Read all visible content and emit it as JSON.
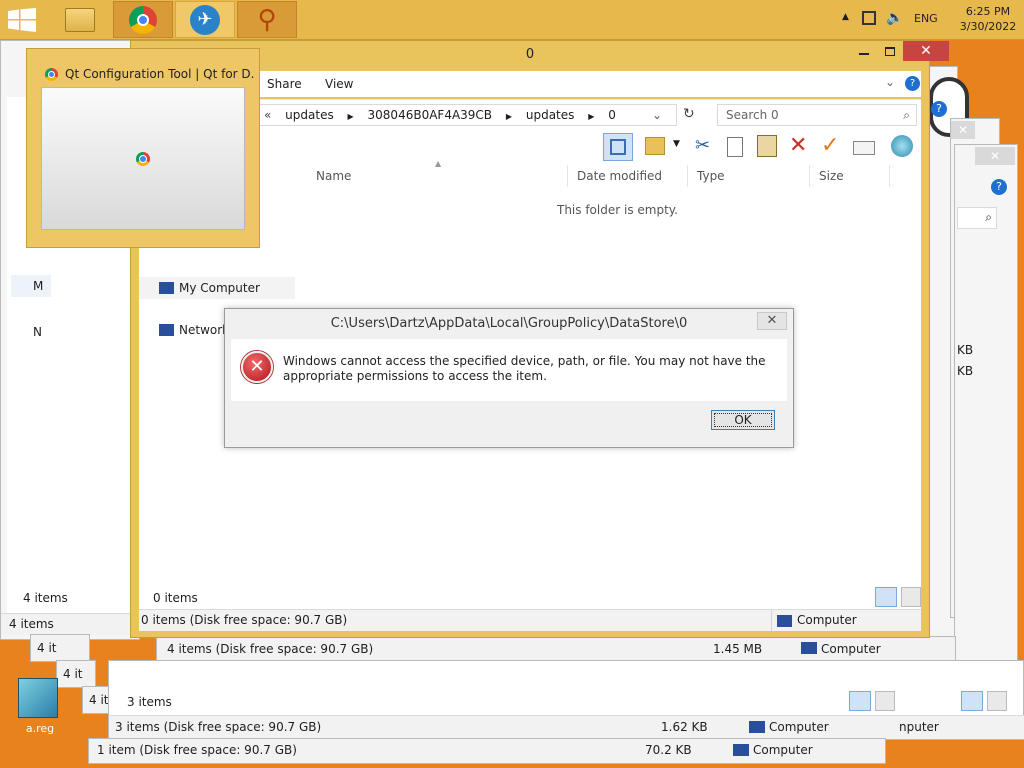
{
  "taskbar": {
    "language": "ENG",
    "time": "6:25 PM",
    "date": "3/30/2022"
  },
  "thumbnail": {
    "title": "Qt Configuration Tool | Qt for D..."
  },
  "front_window": {
    "title": "0",
    "tabs": [
      "Share",
      "View"
    ],
    "breadcrumb": [
      "updates",
      "308046B0AF4A39CB",
      "updates",
      "0"
    ],
    "search_placeholder": "Search 0",
    "columns": [
      "Name",
      "Date modified",
      "Type",
      "Size"
    ],
    "empty_message": "This folder is empty.",
    "nav": [
      "My Computer",
      "Network"
    ],
    "items_count": "0 items",
    "status": "0 items (Disk free space: 90.7 GB)",
    "status_location": "Computer"
  },
  "dialog": {
    "title": "C:\\Users\\Dartz\\AppData\\Local\\GroupPolicy\\DataStore\\0",
    "message": "Windows cannot access the specified device, path, or file. You may not have the appropriate permissions to access the item.",
    "ok_label": "OK"
  },
  "back_windows": {
    "w1_items": "4 items",
    "w1_status": "4 items",
    "w2_status": "4 items (Disk free space: 90.7 GB)",
    "w2_size": "1.45 MB",
    "w2_location": "Computer",
    "w3_items": "3 items",
    "w3_status": "3 items (Disk free space: 90.7 GB)",
    "w3_size": "1.62 KB",
    "w3_location": "Computer",
    "w4_status": "1 item (Disk free space: 90.7 GB)",
    "w4_size": "70.2 KB",
    "w4_location": "Computer",
    "right_partial_1": "KB",
    "right_partial_2": "KB",
    "right_partial_3": "nputer",
    "left_partial_1": "4 it",
    "left_partial_2": "4 it",
    "left_partial_3": "4 it",
    "left_nav_1": "M",
    "left_nav_2": "N"
  },
  "desktop": {
    "icon_label": "a.reg"
  }
}
